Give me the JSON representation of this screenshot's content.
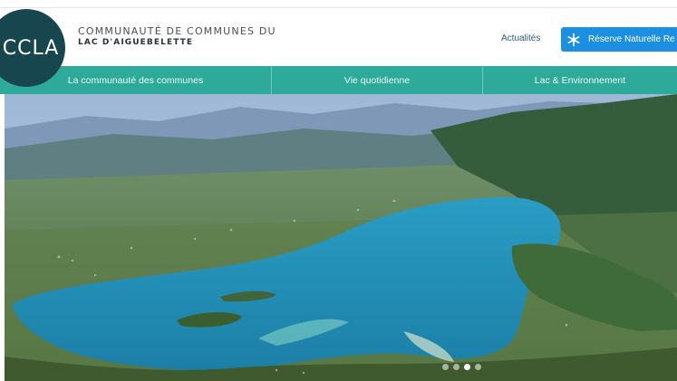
{
  "brand": {
    "logo_text": "CCLA",
    "org_line1": "COMMUNAUTÉ DE COMMUNES DU",
    "org_line2": "LAC D'AIGUEBELETTE"
  },
  "header": {
    "news_link": "Actualités",
    "reserve_button": "Réserve Naturelle Re",
    "reserve_icon": "snowflake-icon"
  },
  "nav": {
    "items": [
      {
        "label": "La communauté des communes"
      },
      {
        "label": "Vie quotidienne"
      },
      {
        "label": "Lac & Environnement"
      }
    ]
  },
  "carousel": {
    "slide_count": 4,
    "active_index": 2
  },
  "colors": {
    "logo_bg": "#17464f",
    "nav_bg": "#2eaa9b",
    "button_bg": "#1d8fe0",
    "lake": "#1f8fb5"
  }
}
